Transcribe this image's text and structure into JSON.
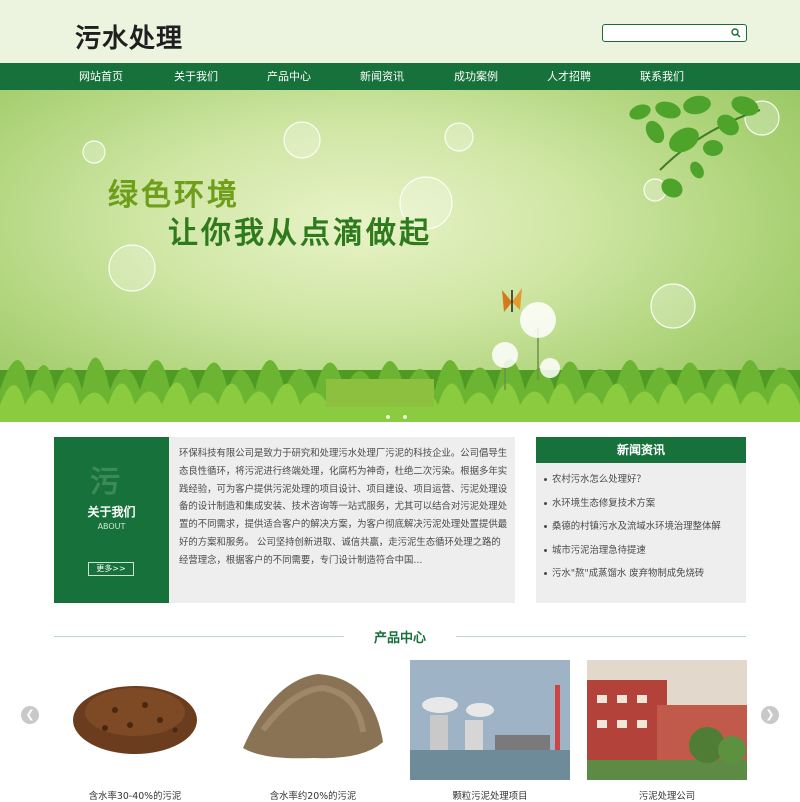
{
  "header": {
    "logo": "污水处理",
    "search": {
      "placeholder": ""
    }
  },
  "nav": {
    "items": [
      "网站首页",
      "关于我们",
      "产品中心",
      "新闻资讯",
      "成功案例",
      "人才招聘",
      "联系我们"
    ]
  },
  "banner": {
    "line1": "绿色环境",
    "line2": "让你我从点滴做起"
  },
  "about": {
    "glyph": "污",
    "title": "关于我们",
    "subtitle": "ABOUT",
    "more": "更多>>",
    "text": "环保科技有限公司是致力于研究和处理污水处理厂污泥的科技企业。公司倡导生态良性循环，将污泥进行终端处理，化腐朽为神奇，杜绝二次污染。根据多年实践经验，可为客户提供污泥处理的项目设计、项目建设、项目运营、污泥处理设备的设计制造和集成安装、技术咨询等一站式服务，尤其可以结合对污泥处理处置的不同需求，提供适合客户的解决方案，为客户彻底解决污泥处理处置提供最好的方案和服务。 公司坚持创新进取、诚信共赢，走污泥生态循环处理之路的经营理念，根据客户的不同需要，专门设计制造符合中国..."
  },
  "news": {
    "title": "新闻资讯",
    "items": [
      "农村污水怎么处理好？",
      "水环境生态修复技术方案",
      "桑德的村镇污水及流域水环境治理整体解",
      "城市污泥治理急待提速",
      "污水\"熬\"成蒸馏水 废弃物制成免烧砖"
    ]
  },
  "products": {
    "title": "产品中心",
    "prev_icon": "chevron-left-icon",
    "next_icon": "chevron-right-icon",
    "items": [
      {
        "caption": "含水率30-40%的污泥"
      },
      {
        "caption": "含水率约20%的污泥"
      },
      {
        "caption": "颗粒污泥处理项目"
      },
      {
        "caption": "污泥处理公司"
      }
    ]
  },
  "colors": {
    "brand_green": "#17713a",
    "header_bg": "#ecf3df",
    "panel_bg": "#eeeeee",
    "accent_lime": "#8dc03f"
  }
}
